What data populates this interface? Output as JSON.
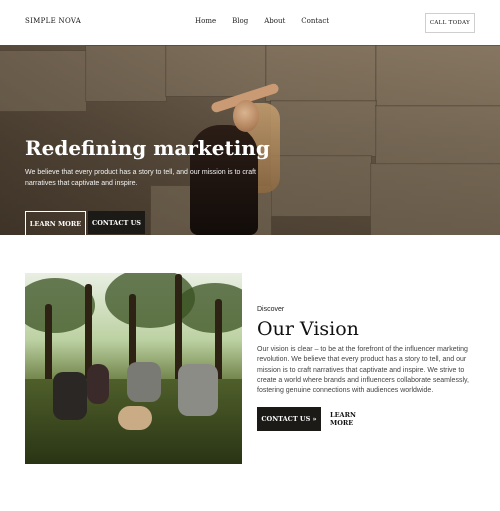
{
  "nav": {
    "brand": "SIMPLE NOVA",
    "links": [
      "Home",
      "Blog",
      "About",
      "Contact"
    ],
    "cta": "CALL TODAY"
  },
  "hero": {
    "title": "Redefining marketing",
    "text": "We believe that every product has a story to tell, and our mission is to craft narratives that captivate and inspire.",
    "btn_learn": "LEARN MORE",
    "btn_contact": "CONTACT US"
  },
  "vision": {
    "eyebrow": "Discover",
    "title": "Our Vision",
    "text": "Our vision is clear – to be at the forefront of the influencer marketing revolution. We believe that every product has a story to tell, and our mission is to craft narratives that captivate and inspire. We strive to create a world where brands and influencers collaborate seamlessly, fostering genuine connections with audiences worldwide.",
    "btn_contact": "CONTACT US »",
    "btn_learn": "LEARN MORE"
  }
}
